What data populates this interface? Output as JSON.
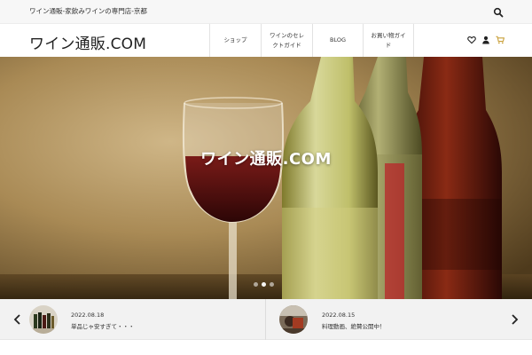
{
  "topbar": {
    "tagline": "ワイン通販-家飲みワインの専門店-京都",
    "search_icon": "search-icon"
  },
  "header": {
    "logo": "ワイン通販.COM",
    "nav": [
      {
        "line1": "ショップ",
        "line2": ""
      },
      {
        "line1": "ワインのセレ",
        "line2": "クトガイド"
      },
      {
        "line1": "BLOG",
        "line2": ""
      },
      {
        "line1": "お買い物ガイ",
        "line2": "ド"
      }
    ],
    "icons": [
      "heart-icon",
      "user-icon",
      "cart-icon"
    ],
    "cart_color": "#c9a03a"
  },
  "hero": {
    "title": "ワイン通販.COM",
    "slides_total": 3,
    "active_slide": 2
  },
  "news": [
    {
      "date": "2022.08.18",
      "title": "単品じゃ安すぎて・・・"
    },
    {
      "date": "2022.08.15",
      "title": "料理動画、絶賛公開中！"
    }
  ]
}
